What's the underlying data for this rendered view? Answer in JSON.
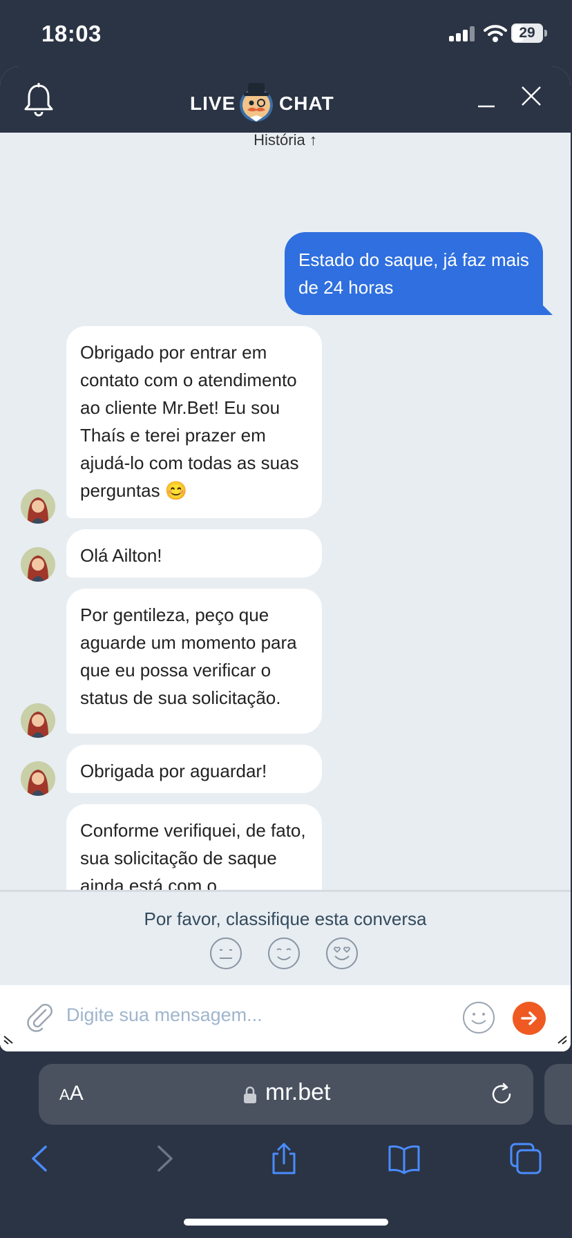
{
  "status_bar": {
    "time": "18:03",
    "battery": "29"
  },
  "chat": {
    "header": {
      "logo_left": "LIVE",
      "logo_right": "CHAT"
    },
    "history_link": "História ↑",
    "messages": [
      {
        "from": "user",
        "text": "Estado do saque, já faz mais de 24 horas"
      },
      {
        "from": "agent",
        "text": "Obrigado por entrar em contato com o atendimento ao cliente Mr.Bet! Eu sou Thaís e terei prazer em ajudá-lo com todas as suas perguntas 😊"
      },
      {
        "from": "agent",
        "text": "Olá Ailton!"
      },
      {
        "from": "agent",
        "text": "Por gentileza, peço que aguarde um momento para que eu possa verificar o status de sua solicitação."
      },
      {
        "from": "agent",
        "text": "Obrigada por aguardar!"
      },
      {
        "from": "agent",
        "text": "Conforme verifiquei, de fato, sua solicitação de saque ainda está com o"
      }
    ],
    "rating": {
      "prompt": "Por favor, classifique esta conversa"
    },
    "input": {
      "placeholder": "Digite sua mensagem..."
    }
  },
  "browser": {
    "aa_label": "AA",
    "url": "mr.bet"
  },
  "colors": {
    "accent_blue": "#2f6fdf",
    "send_orange": "#ee5a22",
    "header_dark": "#2b3444"
  }
}
